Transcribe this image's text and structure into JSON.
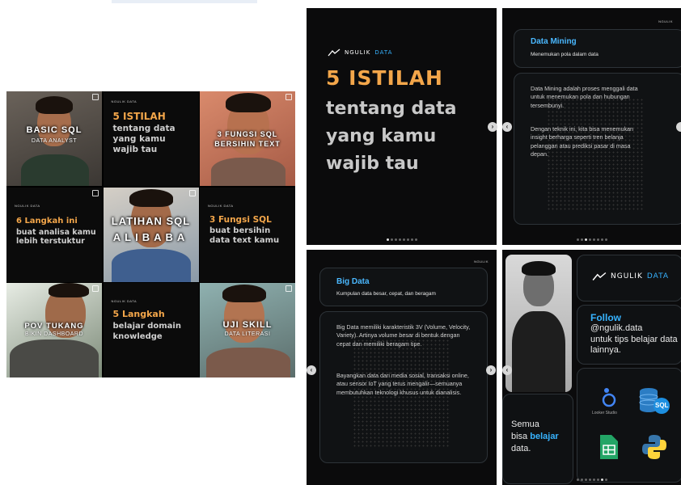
{
  "grid": {
    "tiles": [
      {
        "line1": "BASIC SQL",
        "line2": "DATA ANALYST"
      },
      {
        "brand": "NGULIK DATA",
        "title": "5 ISTILAH",
        "body": "tentang data yang kamu wajib tau"
      },
      {
        "line1": "3 FUNGSI SQL",
        "line2": "BERSIHIN TEXT"
      },
      {
        "brand": "NGULIK DATA",
        "title": "6 Langkah ini",
        "body": "buat analisa kamu lebih terstuktur"
      },
      {
        "line1": "LATIHAN SQL",
        "line2": "ALIBABA"
      },
      {
        "brand": "NGULIK DATA",
        "title": "3 Fungsi SQL",
        "body": "buat bersihin data text kamu"
      },
      {
        "line1": "POV TUKANG",
        "line2": "BIKIN DASHBOARD"
      },
      {
        "brand": "NGULIK DATA",
        "title": "5 Langkah",
        "body": "belajar domain knowledge"
      },
      {
        "line1": "UJI SKILL",
        "line2": "DATA LITERASI"
      }
    ]
  },
  "cover": {
    "brand_a": "NGULIK",
    "brand_b": "DATA",
    "title": "5 ISTILAH",
    "body": [
      "tentang data",
      "yang kamu",
      "wajib tau"
    ]
  },
  "data_mining": {
    "title": "Data Mining",
    "subtitle": "Menemukan pola dalam data",
    "p1": "Data Mining adalah proses menggali data untuk menemukan pola dan hubungan tersembunyi.",
    "p2": "Dengan teknik ini, kita bisa menemukan insight berharga seperti tren belanja pelanggan atau prediksi pasar di masa depan."
  },
  "big_data": {
    "title": "Big Data",
    "subtitle": "Kumpulan data besar, cepat, dan beragam",
    "p1": "Big Data memiliki karakteristik 3V (Volume, Velocity, Variety). Artinya volume besar di bentuk dengan cepat dan memiliki beragam tipe.",
    "p2": "Bayangkan data dari media sosial, transaksi online, atau sensor IoT yang terus mengalir—semuanya membutuhkan teknologi khusus untuk dianalisis."
  },
  "profile": {
    "brand_a": "NGULIK",
    "brand_b": "DATA",
    "follow": "Follow",
    "handle": "@ngulik.data",
    "follow_text": "untuk tips belajar data lainnya.",
    "semua": "Semua",
    "bisa": "bisa",
    "belajar": "belajar",
    "data_word": "data.",
    "looker_label": "Looker Studio",
    "sql_label": "SQL"
  },
  "colors": {
    "accent_orange": "#f3a64a",
    "accent_blue": "#37b3ff",
    "panel_bg": "#0b0b0c"
  }
}
